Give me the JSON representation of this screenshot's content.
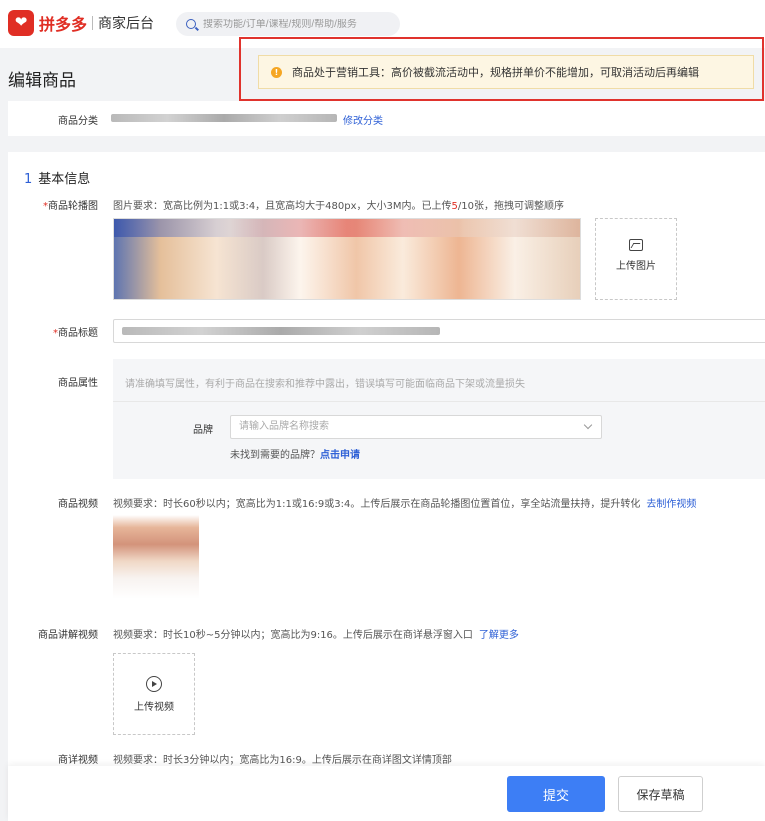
{
  "header": {
    "brand": "拼多多",
    "subtitle": "商家后台",
    "search_placeholder": "搜索功能/订单/课程/规则/帮助/服务"
  },
  "page": {
    "title": "编辑商品"
  },
  "alert": {
    "message": "商品处于营销工具：高价被截流活动中，规格拼单价不能增加，可取消活动后再编辑"
  },
  "category": {
    "label": "商品分类",
    "change_link": "修改分类"
  },
  "basic_info": {
    "section_number": "1",
    "section_title": "基本信息",
    "carousel": {
      "label": "商品轮播图",
      "hint_prefix": "图片要求：宽高比例为1:1或3:4，且宽高均大于480px，大小3M内。已上传",
      "uploaded_count": "5",
      "hint_suffix": "/10张，拖拽可调整顺序",
      "upload_label": "上传图片"
    },
    "title_field": {
      "label": "商品标题"
    },
    "attributes": {
      "label": "商品属性",
      "hint": "请准确填写属性，有利于商品在搜索和推荐中露出，错误填写可能面临商品下架或流量损失",
      "brand_label": "品牌",
      "brand_placeholder": "请输入品牌名称搜索",
      "brand_help": "未找到需要的品牌？",
      "brand_apply_link": "点击申请"
    },
    "video": {
      "label": "商品视频",
      "hint": "视频要求：时长60秒以内；宽高比为1:1或16:9或3:4。上传后展示在商品轮播图位置首位，享全站流量扶持，提升转化",
      "make_link": "去制作视频"
    },
    "explain_video": {
      "label": "商品讲解视频",
      "hint": "视频要求：时长10秒~5分钟以内；宽高比为9:16。上传后展示在商详悬浮窗入口",
      "more_link": "了解更多",
      "upload_label": "上传视频"
    },
    "detail_video": {
      "label": "商详视频",
      "hint": "视频要求：时长3分钟以内；宽高比为16:9。上传后展示在商详图文详情顶部"
    }
  },
  "footer": {
    "submit_label": "提交",
    "draft_label": "保存草稿"
  },
  "colors": {
    "brand_red": "#e02e24",
    "primary_blue": "#3d7ef5",
    "link_blue": "#2e60d6",
    "alert_bg": "#fdf6e3",
    "highlight_frame": "#e0332d"
  }
}
